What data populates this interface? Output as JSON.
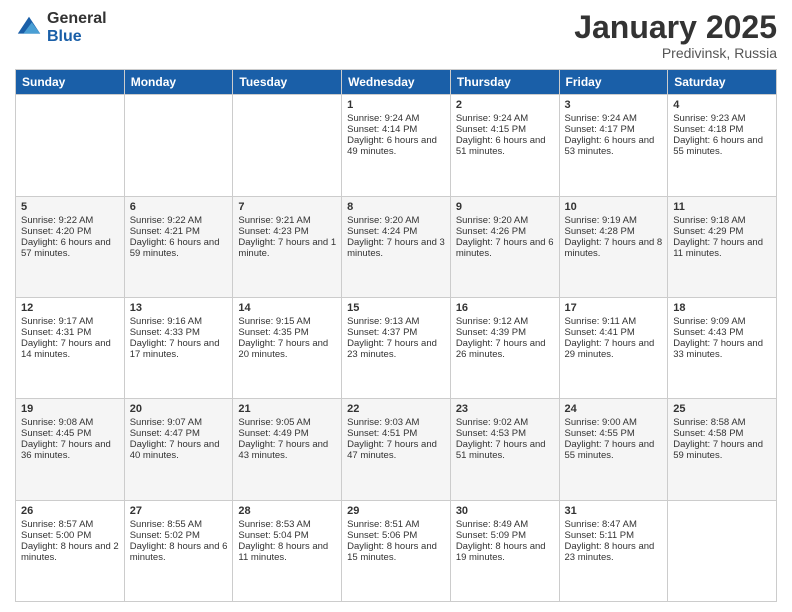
{
  "header": {
    "logo": {
      "general": "General",
      "blue": "Blue"
    },
    "title": "January 2025",
    "subtitle": "Predivinsk, Russia"
  },
  "days_of_week": [
    "Sunday",
    "Monday",
    "Tuesday",
    "Wednesday",
    "Thursday",
    "Friday",
    "Saturday"
  ],
  "weeks": [
    [
      {
        "day": "",
        "sunrise": "",
        "sunset": "",
        "daylight": ""
      },
      {
        "day": "",
        "sunrise": "",
        "sunset": "",
        "daylight": ""
      },
      {
        "day": "",
        "sunrise": "",
        "sunset": "",
        "daylight": ""
      },
      {
        "day": "1",
        "sunrise": "Sunrise: 9:24 AM",
        "sunset": "Sunset: 4:14 PM",
        "daylight": "Daylight: 6 hours and 49 minutes."
      },
      {
        "day": "2",
        "sunrise": "Sunrise: 9:24 AM",
        "sunset": "Sunset: 4:15 PM",
        "daylight": "Daylight: 6 hours and 51 minutes."
      },
      {
        "day": "3",
        "sunrise": "Sunrise: 9:24 AM",
        "sunset": "Sunset: 4:17 PM",
        "daylight": "Daylight: 6 hours and 53 minutes."
      },
      {
        "day": "4",
        "sunrise": "Sunrise: 9:23 AM",
        "sunset": "Sunset: 4:18 PM",
        "daylight": "Daylight: 6 hours and 55 minutes."
      }
    ],
    [
      {
        "day": "5",
        "sunrise": "Sunrise: 9:22 AM",
        "sunset": "Sunset: 4:20 PM",
        "daylight": "Daylight: 6 hours and 57 minutes."
      },
      {
        "day": "6",
        "sunrise": "Sunrise: 9:22 AM",
        "sunset": "Sunset: 4:21 PM",
        "daylight": "Daylight: 6 hours and 59 minutes."
      },
      {
        "day": "7",
        "sunrise": "Sunrise: 9:21 AM",
        "sunset": "Sunset: 4:23 PM",
        "daylight": "Daylight: 7 hours and 1 minute."
      },
      {
        "day": "8",
        "sunrise": "Sunrise: 9:20 AM",
        "sunset": "Sunset: 4:24 PM",
        "daylight": "Daylight: 7 hours and 3 minutes."
      },
      {
        "day": "9",
        "sunrise": "Sunrise: 9:20 AM",
        "sunset": "Sunset: 4:26 PM",
        "daylight": "Daylight: 7 hours and 6 minutes."
      },
      {
        "day": "10",
        "sunrise": "Sunrise: 9:19 AM",
        "sunset": "Sunset: 4:28 PM",
        "daylight": "Daylight: 7 hours and 8 minutes."
      },
      {
        "day": "11",
        "sunrise": "Sunrise: 9:18 AM",
        "sunset": "Sunset: 4:29 PM",
        "daylight": "Daylight: 7 hours and 11 minutes."
      }
    ],
    [
      {
        "day": "12",
        "sunrise": "Sunrise: 9:17 AM",
        "sunset": "Sunset: 4:31 PM",
        "daylight": "Daylight: 7 hours and 14 minutes."
      },
      {
        "day": "13",
        "sunrise": "Sunrise: 9:16 AM",
        "sunset": "Sunset: 4:33 PM",
        "daylight": "Daylight: 7 hours and 17 minutes."
      },
      {
        "day": "14",
        "sunrise": "Sunrise: 9:15 AM",
        "sunset": "Sunset: 4:35 PM",
        "daylight": "Daylight: 7 hours and 20 minutes."
      },
      {
        "day": "15",
        "sunrise": "Sunrise: 9:13 AM",
        "sunset": "Sunset: 4:37 PM",
        "daylight": "Daylight: 7 hours and 23 minutes."
      },
      {
        "day": "16",
        "sunrise": "Sunrise: 9:12 AM",
        "sunset": "Sunset: 4:39 PM",
        "daylight": "Daylight: 7 hours and 26 minutes."
      },
      {
        "day": "17",
        "sunrise": "Sunrise: 9:11 AM",
        "sunset": "Sunset: 4:41 PM",
        "daylight": "Daylight: 7 hours and 29 minutes."
      },
      {
        "day": "18",
        "sunrise": "Sunrise: 9:09 AM",
        "sunset": "Sunset: 4:43 PM",
        "daylight": "Daylight: 7 hours and 33 minutes."
      }
    ],
    [
      {
        "day": "19",
        "sunrise": "Sunrise: 9:08 AM",
        "sunset": "Sunset: 4:45 PM",
        "daylight": "Daylight: 7 hours and 36 minutes."
      },
      {
        "day": "20",
        "sunrise": "Sunrise: 9:07 AM",
        "sunset": "Sunset: 4:47 PM",
        "daylight": "Daylight: 7 hours and 40 minutes."
      },
      {
        "day": "21",
        "sunrise": "Sunrise: 9:05 AM",
        "sunset": "Sunset: 4:49 PM",
        "daylight": "Daylight: 7 hours and 43 minutes."
      },
      {
        "day": "22",
        "sunrise": "Sunrise: 9:03 AM",
        "sunset": "Sunset: 4:51 PM",
        "daylight": "Daylight: 7 hours and 47 minutes."
      },
      {
        "day": "23",
        "sunrise": "Sunrise: 9:02 AM",
        "sunset": "Sunset: 4:53 PM",
        "daylight": "Daylight: 7 hours and 51 minutes."
      },
      {
        "day": "24",
        "sunrise": "Sunrise: 9:00 AM",
        "sunset": "Sunset: 4:55 PM",
        "daylight": "Daylight: 7 hours and 55 minutes."
      },
      {
        "day": "25",
        "sunrise": "Sunrise: 8:58 AM",
        "sunset": "Sunset: 4:58 PM",
        "daylight": "Daylight: 7 hours and 59 minutes."
      }
    ],
    [
      {
        "day": "26",
        "sunrise": "Sunrise: 8:57 AM",
        "sunset": "Sunset: 5:00 PM",
        "daylight": "Daylight: 8 hours and 2 minutes."
      },
      {
        "day": "27",
        "sunrise": "Sunrise: 8:55 AM",
        "sunset": "Sunset: 5:02 PM",
        "daylight": "Daylight: 8 hours and 6 minutes."
      },
      {
        "day": "28",
        "sunrise": "Sunrise: 8:53 AM",
        "sunset": "Sunset: 5:04 PM",
        "daylight": "Daylight: 8 hours and 11 minutes."
      },
      {
        "day": "29",
        "sunrise": "Sunrise: 8:51 AM",
        "sunset": "Sunset: 5:06 PM",
        "daylight": "Daylight: 8 hours and 15 minutes."
      },
      {
        "day": "30",
        "sunrise": "Sunrise: 8:49 AM",
        "sunset": "Sunset: 5:09 PM",
        "daylight": "Daylight: 8 hours and 19 minutes."
      },
      {
        "day": "31",
        "sunrise": "Sunrise: 8:47 AM",
        "sunset": "Sunset: 5:11 PM",
        "daylight": "Daylight: 8 hours and 23 minutes."
      },
      {
        "day": "",
        "sunrise": "",
        "sunset": "",
        "daylight": ""
      }
    ]
  ]
}
